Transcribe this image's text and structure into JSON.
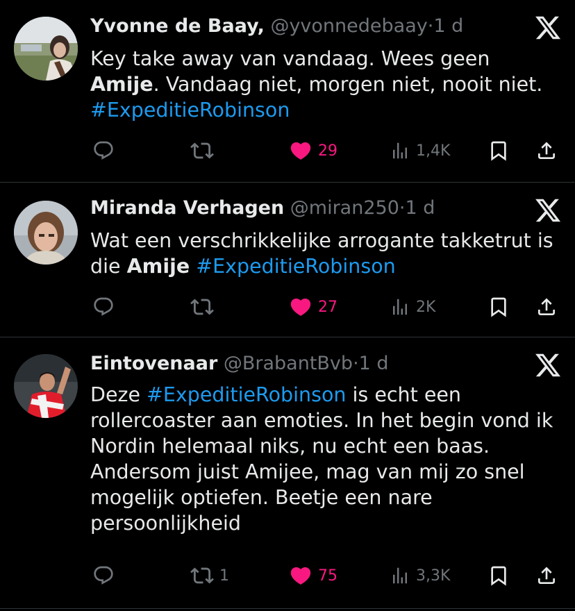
{
  "tweets": [
    {
      "name": "Yvonne de Baay,",
      "handle": "@yvonnedebaay",
      "sep": "·",
      "time": "1 d",
      "text": [
        {
          "t": "plain",
          "v": "Key take away van vandaag. Wees geen "
        },
        {
          "t": "bold",
          "v": "Amije"
        },
        {
          "t": "plain",
          "v": ". Vandaag niet, morgen niet, nooit niet. "
        },
        {
          "t": "tag",
          "v": "#ExpeditieRobinson"
        }
      ],
      "retweets": "",
      "likes": "29",
      "views": "1,4K"
    },
    {
      "name": "Miranda Verhagen",
      "handle": "@miran250",
      "sep": "·",
      "time": "1 d",
      "text": [
        {
          "t": "plain",
          "v": "Wat een verschrikkelijke arrogante takketrut is die "
        },
        {
          "t": "bold",
          "v": "Amije"
        },
        {
          "t": "plain",
          "v": " "
        },
        {
          "t": "tag",
          "v": "#ExpeditieRobinson"
        }
      ],
      "retweets": "",
      "likes": "27",
      "views": "2K"
    },
    {
      "name": "Eintovenaar",
      "handle": "@BrabantBvb",
      "sep": "·",
      "time": "1 d",
      "text": [
        {
          "t": "plain",
          "v": "Deze "
        },
        {
          "t": "tag",
          "v": "#ExpeditieRobinson"
        },
        {
          "t": "plain",
          "v": " is echt een rollercoaster aan emoties. In het begin vond ik Nordin helemaal niks, nu echt een baas. Andersom juist Amijee, mag van mij zo snel mogelijk optiefen. Beetje een nare persoonlijkheid"
        }
      ],
      "retweets": "1",
      "likes": "75",
      "views": "3,3K"
    }
  ],
  "icons": {
    "reply": "reply-icon",
    "retweet": "retweet-icon",
    "like": "heart-filled-icon",
    "views": "views-icon",
    "bookmark": "bookmark-icon",
    "share": "share-icon",
    "x": "x-logo-icon"
  },
  "colors": {
    "background": "#000000",
    "text": "#e7e9ea",
    "muted": "#71767b",
    "hashtag": "#1d9bf0",
    "like": "#f91880",
    "divider": "#2f3336"
  }
}
